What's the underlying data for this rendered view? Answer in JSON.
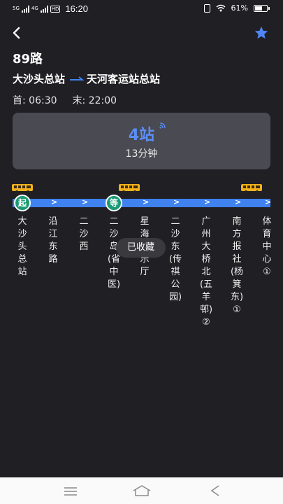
{
  "status_bar": {
    "sig1": "5G",
    "sig2": "4G",
    "hd": "HD",
    "time": "16:20",
    "battery": "61%",
    "battery_fraction": 0.61
  },
  "header": {
    "back_icon": "chevron-left-icon",
    "favorite_icon": "star-icon",
    "accent": "#3f82f0"
  },
  "route": {
    "name": "89路",
    "from": "大沙头总站",
    "to": "天河客运站总站",
    "first_label": "首:",
    "first_time": "06:30",
    "last_label": "末:",
    "last_time": "22:00"
  },
  "arrival": {
    "stops": "4站",
    "minutes": "13分钟"
  },
  "line": {
    "start_badge": "起",
    "wait_badge": "等",
    "stops": [
      "大沙头总站",
      "沿江东路",
      "二沙西",
      "二沙岛(省中医)",
      "星海音乐厅",
      "二沙东(传祺公园)",
      "广州大桥北(五羊邨)②",
      "南方报社(杨箕东)①",
      "体育中心①"
    ],
    "bus_icon": "bus-icon",
    "track_color": "#3f82f0",
    "badge_color": "#1a9a73"
  },
  "toast": "已收藏",
  "nav_bar": {
    "menu_icon": "menu-icon",
    "home_icon": "home-icon",
    "back_icon": "back-icon"
  }
}
